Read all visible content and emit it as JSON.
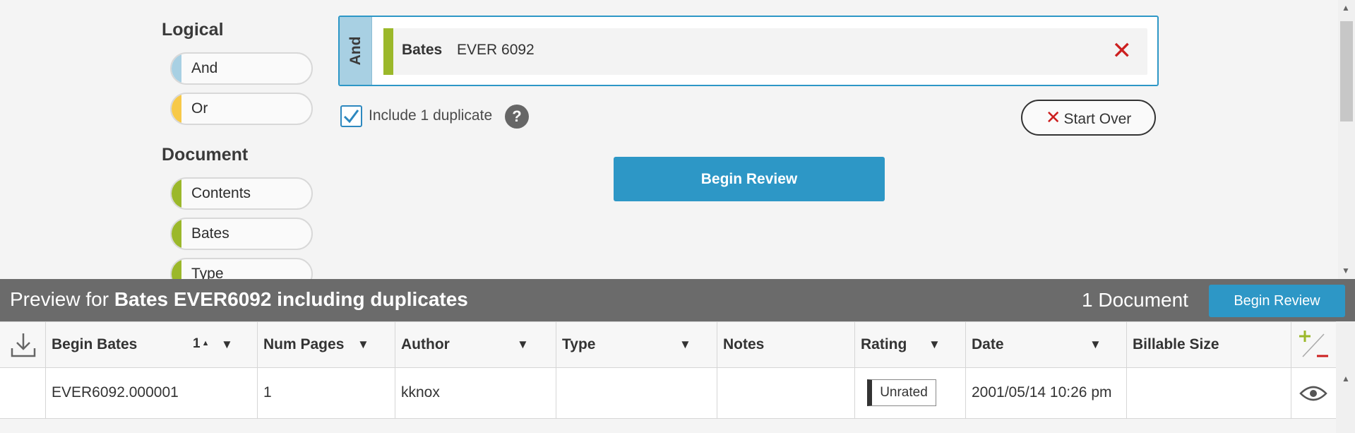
{
  "palette": {
    "logical_title": "Logical",
    "logical_items": [
      {
        "label": "And",
        "color": "#a8d0e3"
      },
      {
        "label": "Or",
        "color": "#f7c948"
      }
    ],
    "document_title": "Document",
    "document_items": [
      {
        "label": "Contents",
        "color": "#9bb82a"
      },
      {
        "label": "Bates",
        "color": "#9bb82a"
      },
      {
        "label": "Type",
        "color": "#9bb82a"
      }
    ]
  },
  "query": {
    "operator": "And",
    "field": "Bates",
    "value": "EVER 6092",
    "remove_symbol": "✕"
  },
  "options": {
    "include_duplicate_label": "Include 1 duplicate",
    "include_duplicate_checked": true,
    "help_symbol": "?",
    "start_over_label": "Start Over",
    "begin_review_label": "Begin Review"
  },
  "preview": {
    "prefix": "Preview for",
    "query_text": "Bates EVER6092 including duplicates",
    "count_label": "1 Document",
    "begin_review_label": "Begin Review"
  },
  "table": {
    "columns": [
      "Begin Bates",
      "Num Pages",
      "Author",
      "Type",
      "Notes",
      "Rating",
      "Date",
      "Billable Size"
    ],
    "sort_order": "1",
    "rows": [
      {
        "begin_bates": "EVER6092.000001",
        "num_pages": "1",
        "author": "kknox",
        "type": "",
        "notes": "",
        "rating": "Unrated",
        "date": "2001/05/14 10:26 pm",
        "billable_size": ""
      }
    ]
  },
  "colors": {
    "accent_blue": "#2d97c6",
    "remove_red": "#cc1f1f",
    "preview_bar": "#6b6b6b"
  }
}
